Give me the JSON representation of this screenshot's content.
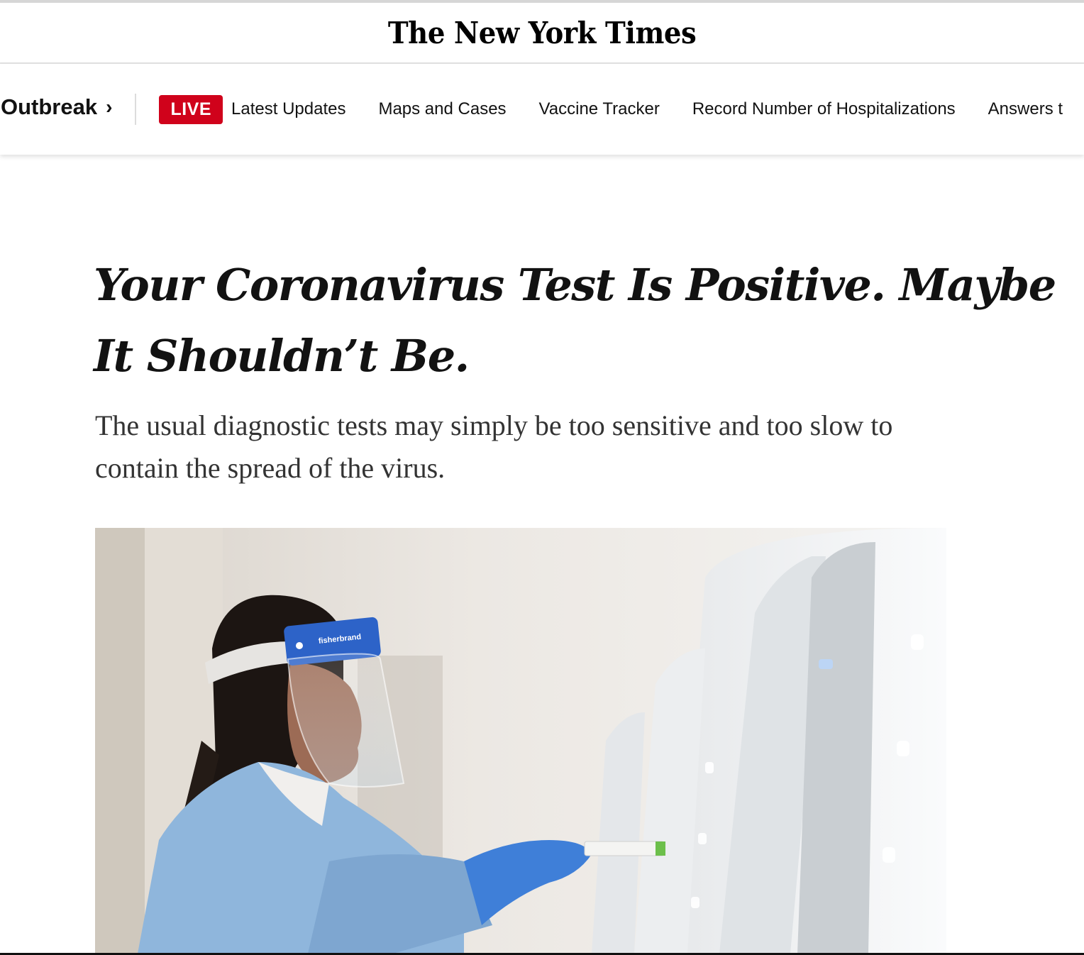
{
  "masthead": {
    "logo_text": "The New York Times"
  },
  "nav": {
    "section_label": "Outbreak",
    "section_chevron": "›",
    "live_label": "LIVE",
    "items": [
      {
        "label": "Latest Updates"
      },
      {
        "label": "Maps and Cases"
      },
      {
        "label": "Vaccine Tracker"
      },
      {
        "label": "Record Number of Hospitalizations"
      },
      {
        "label": "Answers t"
      }
    ]
  },
  "article": {
    "headline": "Your Coronavirus Test Is Positive. Maybe It Shouldn’t Be.",
    "summary": "The usual diagnostic tests may simply be too sensitive and too slow to contain the spread of the virus.",
    "photo": {
      "face_shield_brand": "fisherbrand"
    }
  },
  "colors": {
    "live_red": "#d0021b",
    "text": "#121212",
    "gown_blue": "#8fb6dc",
    "glove_blue": "#3f7fd8"
  }
}
